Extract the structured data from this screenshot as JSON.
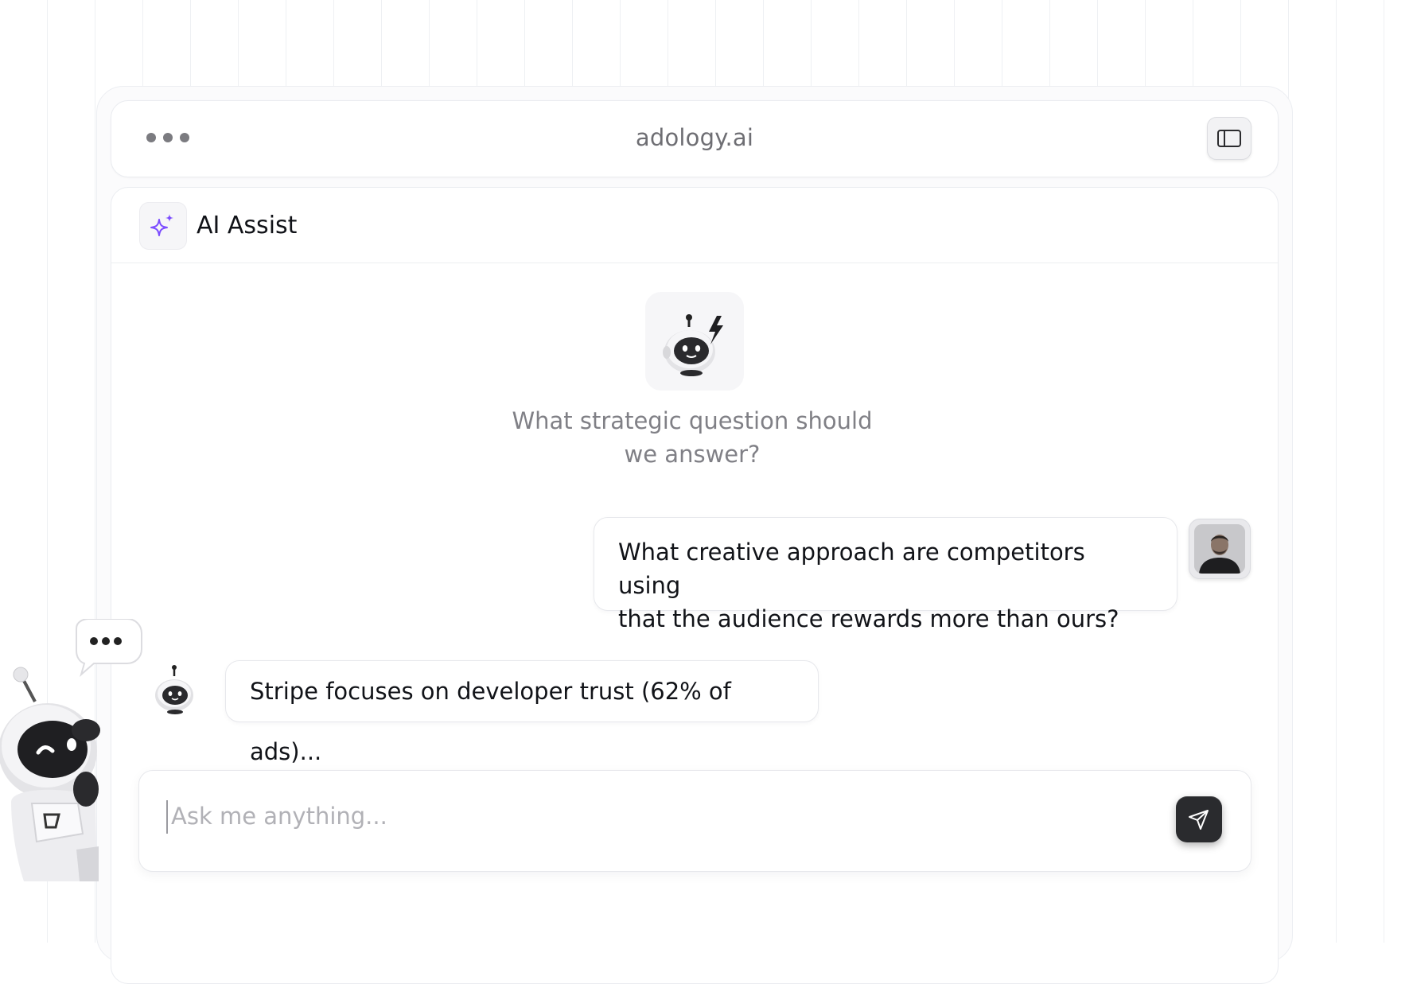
{
  "browser": {
    "url": "adology.ai",
    "menu_icon": "more-dots-icon",
    "sidebar_toggle_icon": "sidebar-toggle-icon"
  },
  "header": {
    "icon": "sparkles-icon",
    "title": "AI Assist",
    "accent_color": "#7c4dff"
  },
  "empty_state": {
    "icon": "robot-lightning-icon",
    "prompt_line1": "What strategic question should",
    "prompt_line2": "we answer?"
  },
  "messages": [
    {
      "role": "user",
      "line1": "What creative approach are competitors using",
      "line2": "that the audience rewards more than ours?",
      "avatar": "user-avatar"
    },
    {
      "role": "assistant",
      "text": "Stripe focuses on developer trust (62% of ads)...",
      "avatar": "robot-icon"
    }
  ],
  "composer": {
    "placeholder": "Ask me anything...",
    "value": "",
    "send_icon": "send-icon"
  },
  "mascot": {
    "icon": "robot-mascot",
    "speech_bubble_icon": "typing-dots-icon"
  }
}
